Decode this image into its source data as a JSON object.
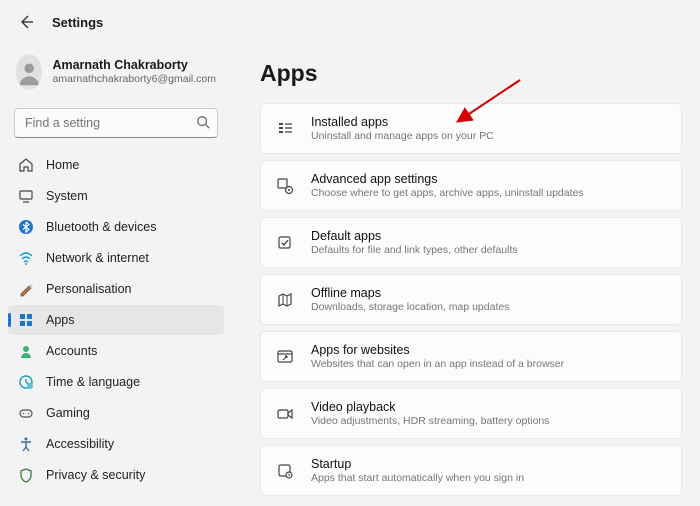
{
  "header": {
    "title": "Settings"
  },
  "user": {
    "name": "Amarnath Chakraborty",
    "email": "amarnathchakraborty6@gmail.com"
  },
  "search": {
    "placeholder": "Find a setting"
  },
  "nav": {
    "items": [
      {
        "label": "Home",
        "icon": "home",
        "active": false
      },
      {
        "label": "System",
        "icon": "system",
        "active": false
      },
      {
        "label": "Bluetooth & devices",
        "icon": "bluetooth",
        "active": false
      },
      {
        "label": "Network & internet",
        "icon": "wifi",
        "active": false
      },
      {
        "label": "Personalisation",
        "icon": "personalise",
        "active": false
      },
      {
        "label": "Apps",
        "icon": "apps",
        "active": true
      },
      {
        "label": "Accounts",
        "icon": "accounts",
        "active": false
      },
      {
        "label": "Time & language",
        "icon": "time",
        "active": false
      },
      {
        "label": "Gaming",
        "icon": "gaming",
        "active": false
      },
      {
        "label": "Accessibility",
        "icon": "accessibility",
        "active": false
      },
      {
        "label": "Privacy & security",
        "icon": "privacy",
        "active": false
      }
    ]
  },
  "page": {
    "heading": "Apps",
    "cards": [
      {
        "title": "Installed apps",
        "sub": "Uninstall and manage apps on your PC",
        "icon": "installed"
      },
      {
        "title": "Advanced app settings",
        "sub": "Choose where to get apps, archive apps, uninstall updates",
        "icon": "advanced"
      },
      {
        "title": "Default apps",
        "sub": "Defaults for file and link types, other defaults",
        "icon": "default"
      },
      {
        "title": "Offline maps",
        "sub": "Downloads, storage location, map updates",
        "icon": "maps"
      },
      {
        "title": "Apps for websites",
        "sub": "Websites that can open in an app instead of a browser",
        "icon": "websites"
      },
      {
        "title": "Video playback",
        "sub": "Video adjustments, HDR streaming, battery options",
        "icon": "video"
      },
      {
        "title": "Startup",
        "sub": "Apps that start automatically when you sign in",
        "icon": "startup"
      }
    ]
  },
  "annotation": {
    "arrow_target": "Installed apps"
  }
}
